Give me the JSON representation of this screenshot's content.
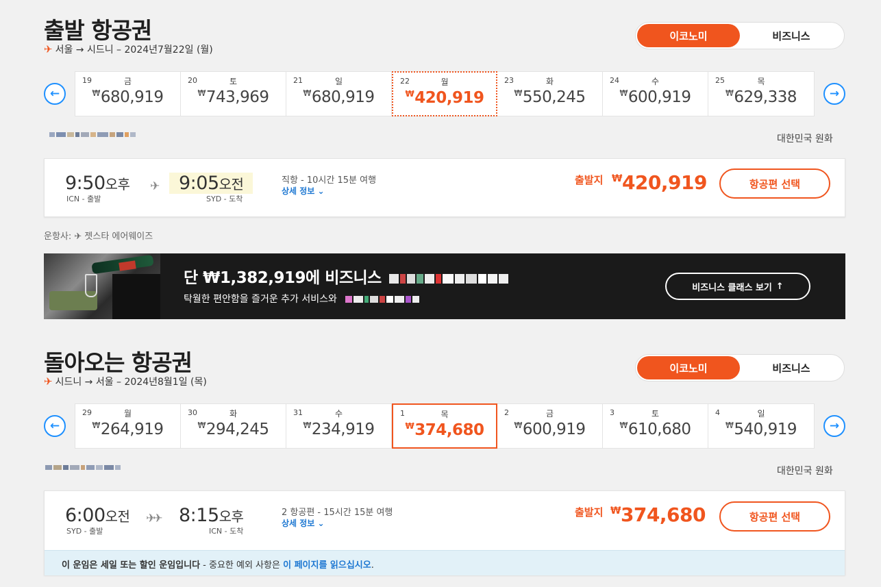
{
  "outbound": {
    "title": "출발 항공권",
    "route": "서울 → 시드니 – 2024년7월22일 (월)",
    "cabin": {
      "economy": "이코노미",
      "business": "비즈니스"
    },
    "dates": [
      {
        "day": "19",
        "weekday": "금",
        "price": "680,919"
      },
      {
        "day": "20",
        "weekday": "토",
        "price": "743,969"
      },
      {
        "day": "21",
        "weekday": "일",
        "price": "680,919"
      },
      {
        "day": "22",
        "weekday": "월",
        "price": "420,919"
      },
      {
        "day": "23",
        "weekday": "화",
        "price": "550,245"
      },
      {
        "day": "24",
        "weekday": "수",
        "price": "600,919"
      },
      {
        "day": "25",
        "weekday": "목",
        "price": "629,338"
      }
    ],
    "currency_label": "대한민국 원화",
    "flight": {
      "depart_time": "9:50",
      "depart_ampm": "오후",
      "depart_airport": "ICN - 출발",
      "arrive_time": "9:05",
      "arrive_ampm": "오전",
      "arrive_airport": "SYD - 도착",
      "duration": "직항 - 10시간 15분 여행",
      "details": "상세 정보",
      "from_label": "출발지",
      "price": "420,919",
      "select": "항공편 선택"
    },
    "operated_by": "운항사: ✈ 젯스타 에어웨이즈"
  },
  "banner": {
    "title_start": "단 ₩1,382,919에 비즈니스",
    "subtitle_start": "탁월한 편안함을 즐거운 추가 서비스와",
    "button": "비즈니스 클래스 보기"
  },
  "inbound": {
    "title": "돌아오는 항공권",
    "route": "시드니 → 서울 – 2024년8월1일 (목)",
    "cabin": {
      "economy": "이코노미",
      "business": "비즈니스"
    },
    "dates": [
      {
        "day": "29",
        "weekday": "월",
        "price": "264,919"
      },
      {
        "day": "30",
        "weekday": "화",
        "price": "294,245"
      },
      {
        "day": "31",
        "weekday": "수",
        "price": "234,919"
      },
      {
        "day": "1",
        "weekday": "목",
        "price": "374,680"
      },
      {
        "day": "2",
        "weekday": "금",
        "price": "600,919"
      },
      {
        "day": "3",
        "weekday": "토",
        "price": "610,680"
      },
      {
        "day": "4",
        "weekday": "일",
        "price": "540,919"
      }
    ],
    "currency_label": "대한민국 원화",
    "flight": {
      "depart_time": "6:00",
      "depart_ampm": "오전",
      "depart_airport": "SYD - 출발",
      "arrive_time": "8:15",
      "arrive_ampm": "오후",
      "arrive_airport": "ICN - 도착",
      "duration": "2 항공편 - 15시간 15분 여행",
      "details": "상세 정보",
      "from_label": "출발지",
      "price": "374,680",
      "select": "항공편 선택"
    }
  },
  "notice": {
    "bold": "이 운임은 세일 또는 할인 운임입니다",
    "middle": " - 중요한 예외 사항은 ",
    "link": "이 페이지를 읽으십시오",
    "end": "."
  },
  "colors": {
    "accent": "#f0551e",
    "link": "#1e78d2",
    "nav": "#1e90ff"
  }
}
